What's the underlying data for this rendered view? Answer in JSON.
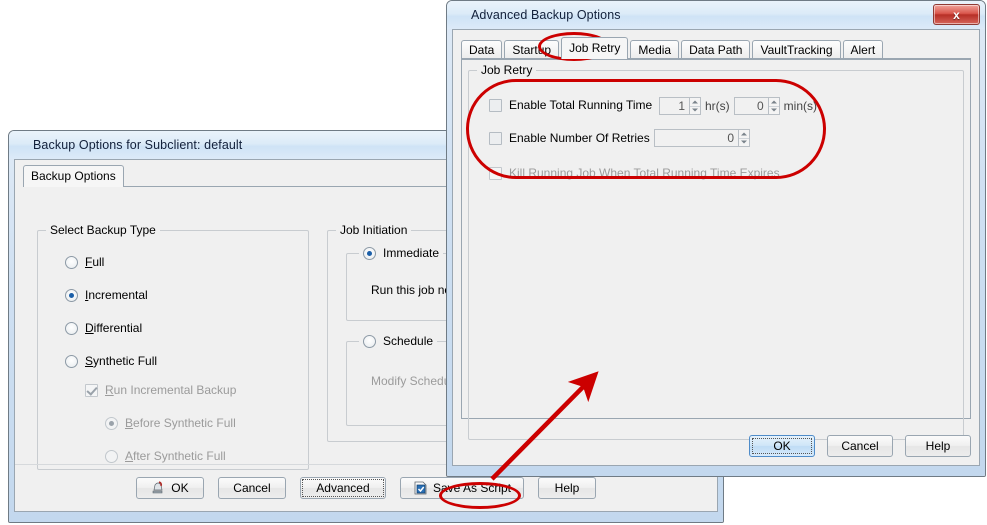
{
  "backup_window": {
    "title": "Backup Options for Subclient: default",
    "tabs": [
      {
        "label": "Backup Options",
        "selected": true
      }
    ],
    "backup_type_group": {
      "label": "Select Backup Type",
      "options": [
        {
          "label": "Full",
          "mnemonic": "F",
          "selected": false,
          "enabled": true
        },
        {
          "label": "Incremental",
          "mnemonic": "I",
          "selected": true,
          "enabled": true
        },
        {
          "label": "Differential",
          "mnemonic": "D",
          "selected": false,
          "enabled": true
        },
        {
          "label": "Synthetic Full",
          "mnemonic": "S",
          "selected": false,
          "enabled": true
        }
      ],
      "run_incremental": {
        "label": "Run Incremental Backup",
        "mnemonic": "R",
        "checked": true,
        "enabled": false
      },
      "sub_options": [
        {
          "label": "Before Synthetic Full",
          "mnemonic": "B",
          "selected": true,
          "enabled": false
        },
        {
          "label": "After Synthetic Full",
          "mnemonic": "A",
          "selected": false,
          "enabled": false
        }
      ]
    },
    "job_initiation_group": {
      "label": "Job Initiation",
      "immediate": {
        "label": "Immediate",
        "selected": true,
        "description": "Run this job now"
      },
      "schedule": {
        "label": "Schedule",
        "selected": false,
        "description": "Modify Schedule"
      }
    },
    "buttons": [
      {
        "label": "OK",
        "icon": "ok-stamp-icon",
        "focused": false
      },
      {
        "label": "Cancel",
        "icon": null,
        "focused": false
      },
      {
        "label": "Advanced",
        "icon": null,
        "focused": true
      },
      {
        "label": "Save As Script",
        "icon": "script-icon",
        "focused": false
      },
      {
        "label": "Help",
        "icon": null,
        "focused": false
      }
    ]
  },
  "advanced_window": {
    "title": "Advanced Backup Options",
    "close_label": "x",
    "tabs": [
      {
        "label": "Data",
        "selected": false
      },
      {
        "label": "Startup",
        "selected": false
      },
      {
        "label": "Job Retry",
        "selected": true
      },
      {
        "label": "Media",
        "selected": false
      },
      {
        "label": "Data Path",
        "selected": false
      },
      {
        "label": "VaultTracking",
        "selected": false
      },
      {
        "label": "Alert",
        "selected": false
      }
    ],
    "job_retry_group": {
      "label": "Job Retry",
      "total_running_time": {
        "label": "Enable Total Running Time",
        "checked": false,
        "enabled": true,
        "hours_value": "1",
        "hours_unit": "hr(s)",
        "minutes_value": "0",
        "minutes_unit": "min(s)"
      },
      "number_of_retries": {
        "label": "Enable Number Of Retries",
        "checked": false,
        "enabled": true,
        "value": "0"
      },
      "kill_running_job": {
        "label": "Kill Running Job When Total Running Time Expires",
        "checked": false,
        "enabled": false
      }
    },
    "buttons": [
      {
        "label": "OK",
        "focused": true
      },
      {
        "label": "Cancel",
        "focused": false
      },
      {
        "label": "Help",
        "focused": false
      }
    ]
  },
  "annotations": {
    "accent_color": "#cc0000",
    "ellipse_job_retry_tab": "highlight around Job Retry tab",
    "ellipse_job_retry_panel": "highlight around Job Retry options",
    "ellipse_advanced_button": "highlight around Advanced button",
    "arrow": "arrow from Advanced button to Advanced Backup Options dialog"
  }
}
